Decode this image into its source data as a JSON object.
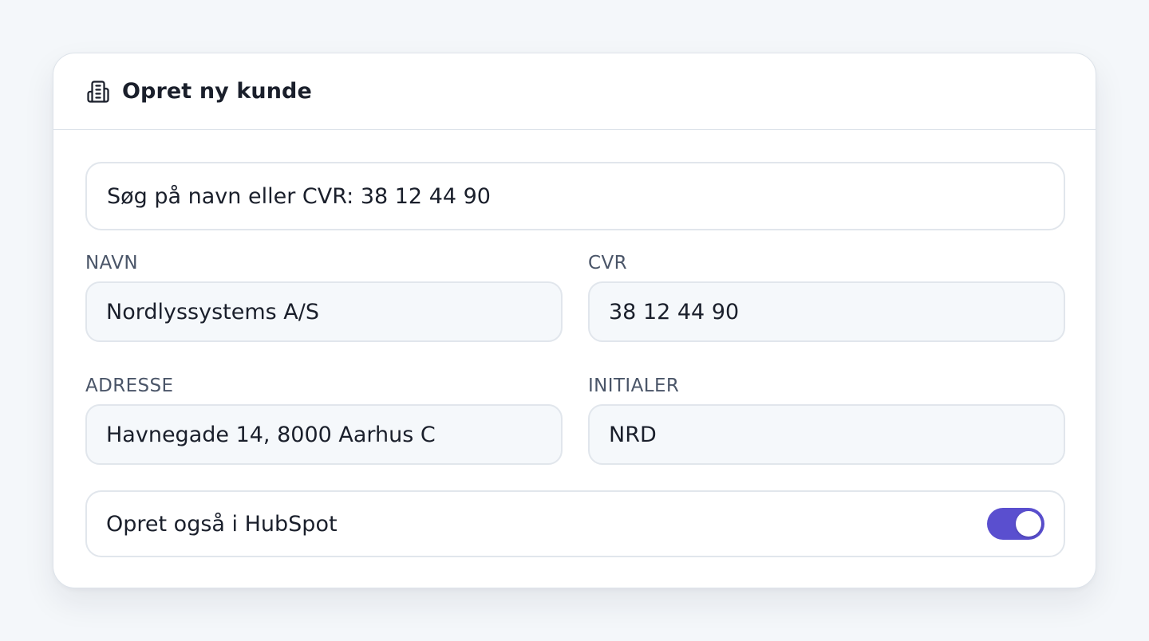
{
  "card": {
    "title": "Opret ny kunde",
    "icon": "building-icon"
  },
  "search": {
    "value": "Søg på navn eller CVR: 38 12 44 90"
  },
  "fields": {
    "navn": {
      "label": "NAVN",
      "value": "Nordlyssystems A/S"
    },
    "cvr": {
      "label": "CVR",
      "value": "38 12 44 90"
    },
    "adresse": {
      "label": "ADRESSE",
      "value": "Havnegade 14, 8000 Aarhus C"
    },
    "initialer": {
      "label": "INITIALER",
      "value": "NRD"
    }
  },
  "hubspot": {
    "label": "Opret også i HubSpot",
    "enabled": true
  },
  "colors": {
    "accent": "#5a4fcf",
    "background": "#f4f7fa",
    "input_bg": "#f5f8fb",
    "border": "#e1e6ec"
  }
}
